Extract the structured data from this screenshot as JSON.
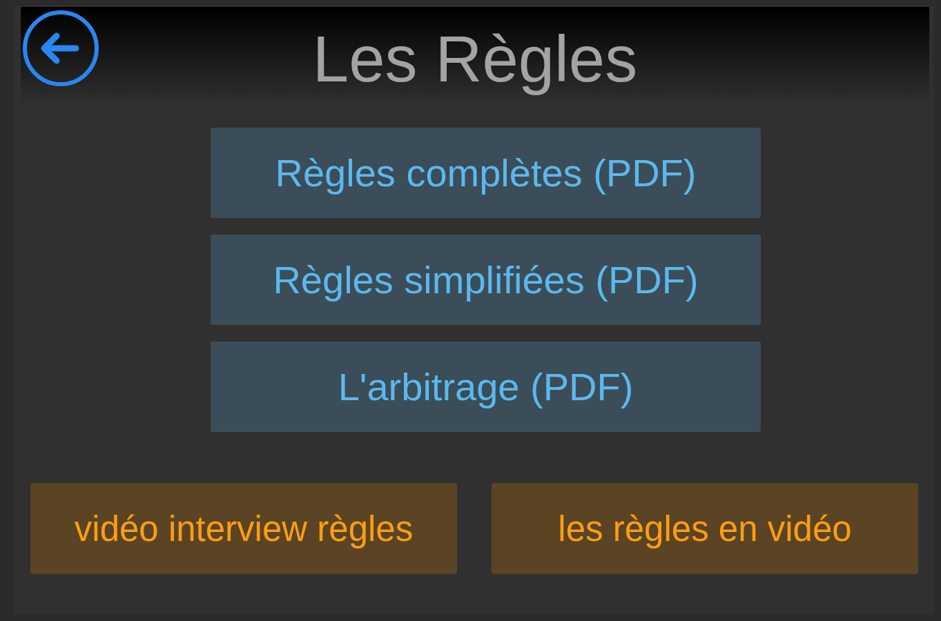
{
  "header": {
    "title": "Les Règles"
  },
  "documents": [
    {
      "label": "Règles complètes (PDF)"
    },
    {
      "label": "Règles simplifiées (PDF)"
    },
    {
      "label": "L'arbitrage (PDF)"
    }
  ],
  "videos": [
    {
      "label": "vidéo interview règles"
    },
    {
      "label": "les règles en vidéo"
    }
  ]
}
